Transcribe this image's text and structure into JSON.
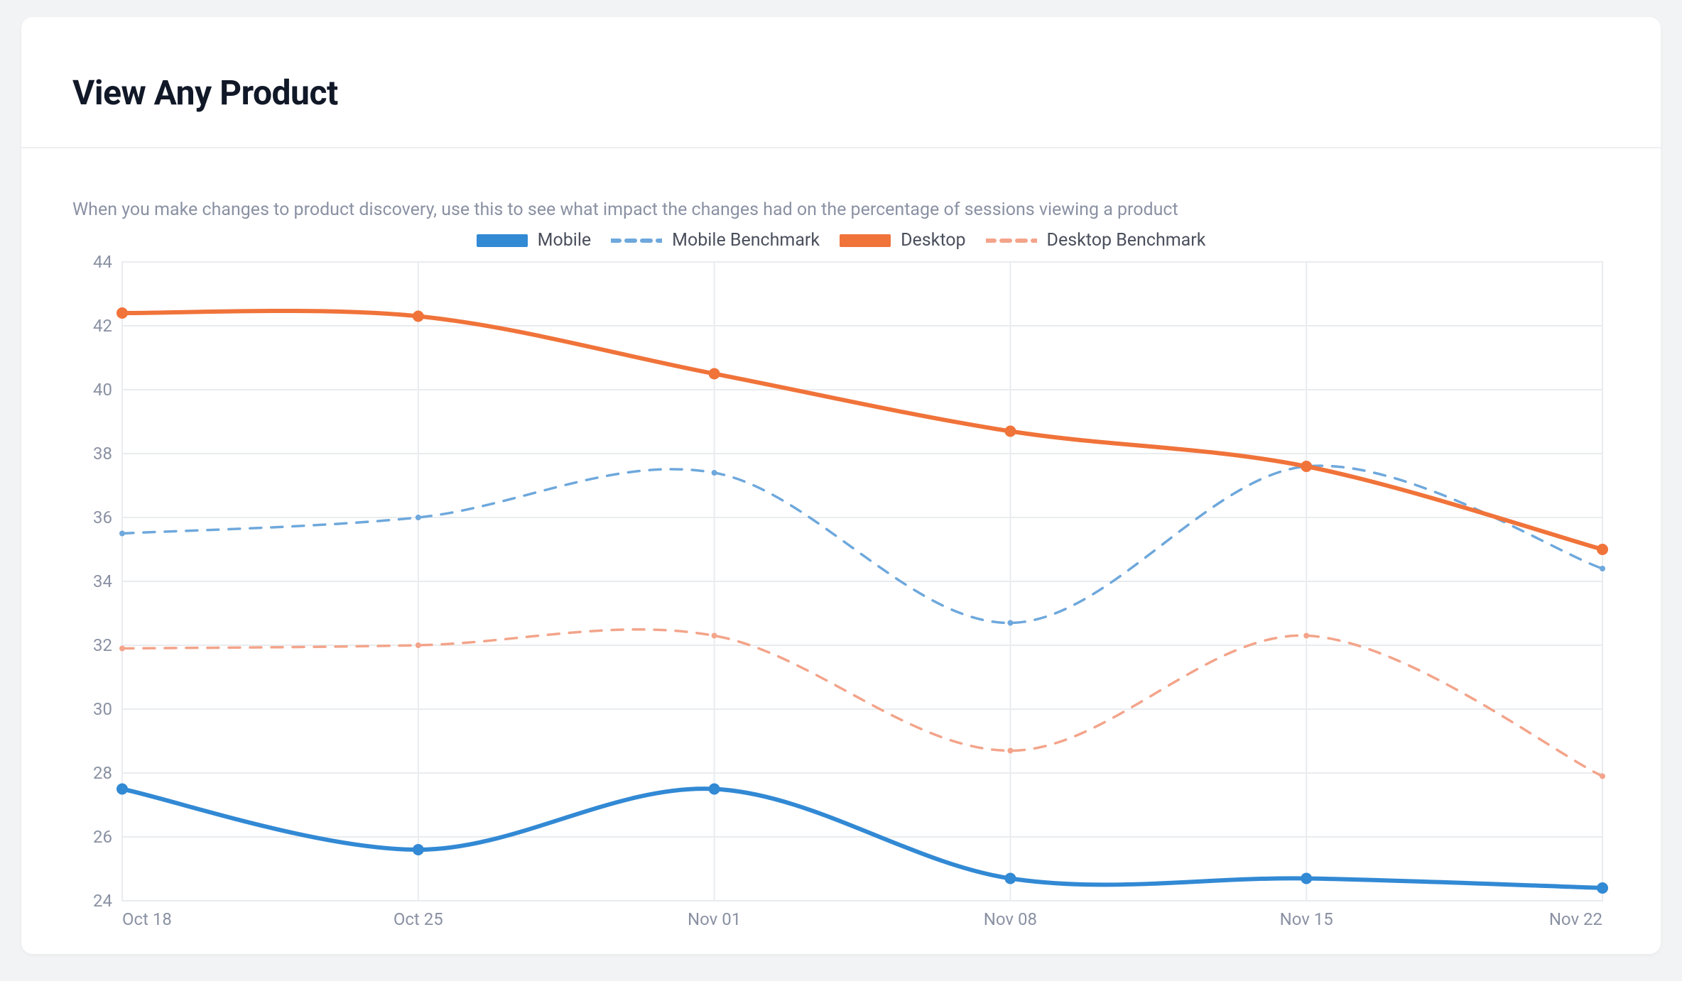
{
  "header": {
    "title": "View Any Product"
  },
  "subtitle": "When you make changes to product discovery, use this to see what impact the changes had on the percentage of sessions viewing a product",
  "legend": {
    "mobile": "Mobile",
    "mobile_benchmark": "Mobile Benchmark",
    "desktop": "Desktop",
    "desktop_benchmark": "Desktop Benchmark"
  },
  "colors": {
    "mobile": "#3289d4",
    "mobile_benchmark": "#6ea8dc",
    "desktop": "#f0733a",
    "desktop_benchmark": "#f3a48a",
    "grid": "#e9ecef",
    "axis_text": "#8a91a3"
  },
  "chart_data": {
    "type": "line",
    "categories": [
      "Oct 18",
      "Oct 25",
      "Nov 01",
      "Nov 08",
      "Nov 15",
      "Nov 22"
    ],
    "series": [
      {
        "name": "Mobile",
        "style": "solid",
        "color": "#3289d4",
        "values": [
          27.5,
          25.6,
          27.5,
          24.7,
          24.7,
          24.4
        ]
      },
      {
        "name": "Mobile Benchmark",
        "style": "dashed",
        "color": "#6ea8dc",
        "values": [
          35.5,
          36.0,
          37.4,
          32.7,
          37.6,
          34.4
        ]
      },
      {
        "name": "Desktop",
        "style": "solid",
        "color": "#f0733a",
        "values": [
          42.4,
          42.3,
          40.5,
          38.7,
          37.6,
          35.0
        ]
      },
      {
        "name": "Desktop Benchmark",
        "style": "dashed",
        "color": "#f3a48a",
        "values": [
          31.9,
          32.0,
          32.3,
          28.7,
          32.3,
          27.9
        ]
      }
    ],
    "ylim": [
      24,
      44
    ],
    "ytick_step": 2,
    "title": "",
    "xlabel": "",
    "ylabel": ""
  }
}
